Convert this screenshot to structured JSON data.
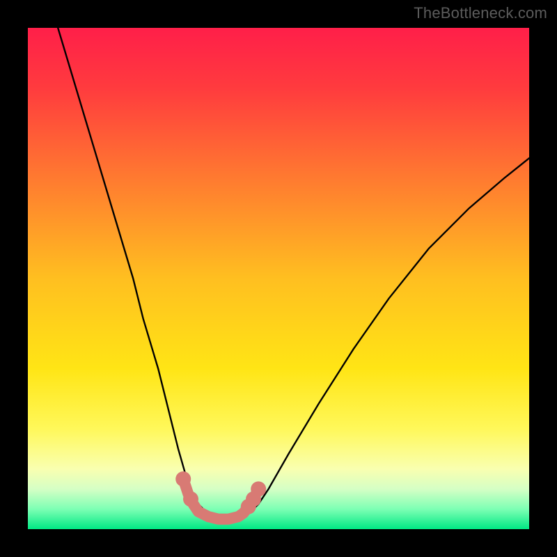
{
  "watermark": "TheBottleneck.com",
  "chart_data": {
    "type": "line",
    "title": "",
    "xlabel": "",
    "ylabel": "",
    "xlim": [
      0,
      100
    ],
    "ylim": [
      0,
      100
    ],
    "grid": false,
    "legend": false,
    "gradient_stops": [
      {
        "offset": 0.0,
        "color": "#ff1f49"
      },
      {
        "offset": 0.12,
        "color": "#ff3b3e"
      },
      {
        "offset": 0.3,
        "color": "#ff7a30"
      },
      {
        "offset": 0.5,
        "color": "#ffbf20"
      },
      {
        "offset": 0.68,
        "color": "#ffe515"
      },
      {
        "offset": 0.8,
        "color": "#fff85a"
      },
      {
        "offset": 0.88,
        "color": "#f9ffb0"
      },
      {
        "offset": 0.92,
        "color": "#d5ffc5"
      },
      {
        "offset": 0.96,
        "color": "#7dffb4"
      },
      {
        "offset": 1.0,
        "color": "#00e884"
      }
    ],
    "series": [
      {
        "name": "curve",
        "style": "thin-black",
        "points": [
          {
            "x": 6,
            "y": 100
          },
          {
            "x": 9,
            "y": 90
          },
          {
            "x": 12,
            "y": 80
          },
          {
            "x": 15,
            "y": 70
          },
          {
            "x": 18,
            "y": 60
          },
          {
            "x": 21,
            "y": 50
          },
          {
            "x": 23,
            "y": 42
          },
          {
            "x": 26,
            "y": 32
          },
          {
            "x": 28,
            "y": 24
          },
          {
            "x": 30,
            "y": 16
          },
          {
            "x": 32,
            "y": 9
          },
          {
            "x": 34,
            "y": 5
          },
          {
            "x": 36,
            "y": 3
          },
          {
            "x": 38,
            "y": 2
          },
          {
            "x": 40,
            "y": 2
          },
          {
            "x": 42,
            "y": 2
          },
          {
            "x": 44,
            "y": 3
          },
          {
            "x": 46,
            "y": 5
          },
          {
            "x": 48,
            "y": 8
          },
          {
            "x": 52,
            "y": 15
          },
          {
            "x": 58,
            "y": 25
          },
          {
            "x": 65,
            "y": 36
          },
          {
            "x": 72,
            "y": 46
          },
          {
            "x": 80,
            "y": 56
          },
          {
            "x": 88,
            "y": 64
          },
          {
            "x": 95,
            "y": 70
          },
          {
            "x": 100,
            "y": 74
          }
        ]
      },
      {
        "name": "highlight",
        "style": "thick-salmon",
        "points": [
          {
            "x": 31,
            "y": 10
          },
          {
            "x": 32,
            "y": 7
          },
          {
            "x": 33,
            "y": 5
          },
          {
            "x": 34,
            "y": 3.5
          },
          {
            "x": 36,
            "y": 2.5
          },
          {
            "x": 38,
            "y": 2
          },
          {
            "x": 40,
            "y": 2
          },
          {
            "x": 42,
            "y": 2.5
          },
          {
            "x": 43,
            "y": 3.2
          },
          {
            "x": 44,
            "y": 4.5
          },
          {
            "x": 45,
            "y": 6
          },
          {
            "x": 46,
            "y": 8
          }
        ],
        "dots": [
          {
            "x": 31,
            "y": 10
          },
          {
            "x": 32.5,
            "y": 6
          },
          {
            "x": 44,
            "y": 4.5
          },
          {
            "x": 45,
            "y": 6
          },
          {
            "x": 46,
            "y": 8
          }
        ]
      }
    ]
  }
}
